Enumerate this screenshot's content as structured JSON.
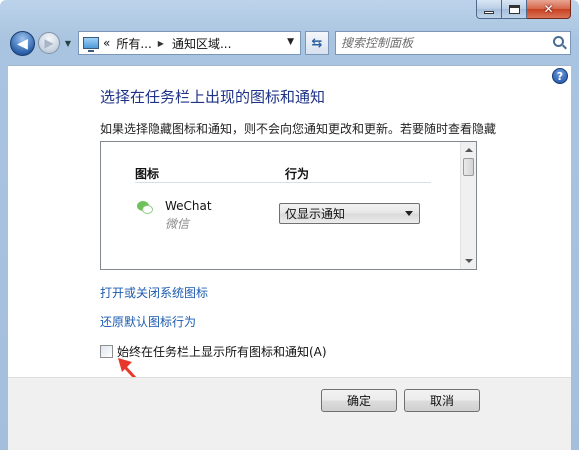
{
  "window": {
    "close_glyph": "✕"
  },
  "nav": {
    "back_glyph": "◀",
    "forward_glyph": "▶",
    "breadcrumbs": [
      "«",
      "所有...",
      "通知区域..."
    ],
    "refresh_glyph": "⇆",
    "search_placeholder": "搜索控制面板"
  },
  "main": {
    "help_glyph": "?",
    "title": "选择在任务栏上出现的图标和通知",
    "description": "如果选择隐藏图标和通知，则不会向您通知更改和更新。若要随时查看隐藏的图标，请单击任务栏上通知区域旁的箭头。",
    "list": {
      "col_icon": "图标",
      "col_behavior": "行为",
      "rows": [
        {
          "name": "WeChat",
          "subtitle": "微信",
          "behavior": "仅显示通知"
        }
      ]
    },
    "link_system_icons": "打开或关闭系统图标",
    "link_restore": "还原默认图标行为",
    "checkbox_label": "始终在任务栏上显示所有图标和通知(A)",
    "checkbox_checked": false
  },
  "footer": {
    "ok_label": "确定",
    "cancel_label": "取消"
  },
  "colors": {
    "title_blue": "#1e3287",
    "link_blue": "#1c5bb0",
    "annotation_red": "#e8382b"
  },
  "icons": [
    "back-arrow-icon",
    "forward-arrow-icon",
    "computer-icon",
    "refresh-icon",
    "search-icon",
    "help-icon",
    "wechat-icon",
    "dropdown-arrow-icon",
    "red-arrow-annotation-icon"
  ]
}
